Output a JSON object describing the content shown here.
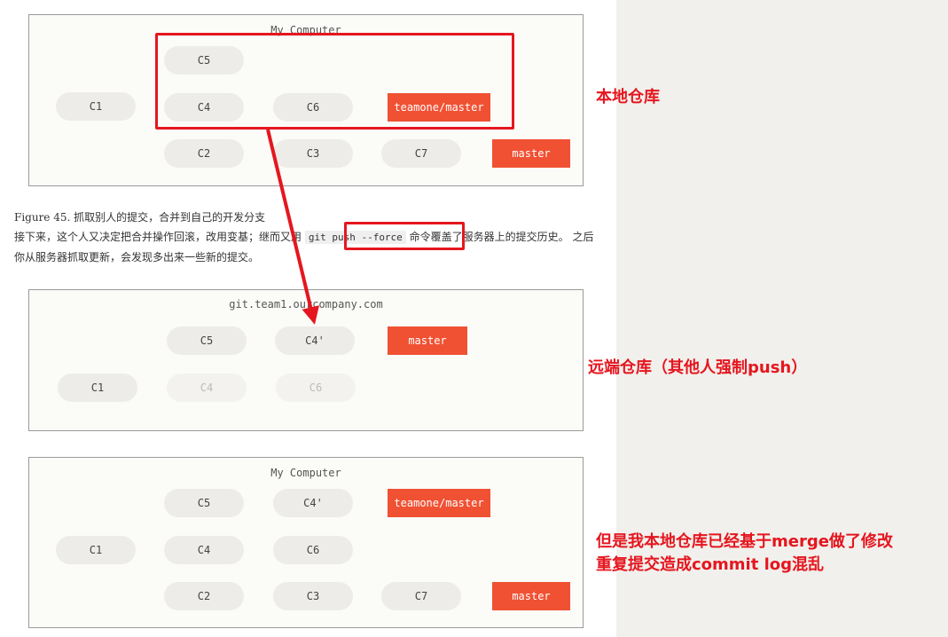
{
  "diagram1": {
    "title": "My Computer",
    "nodes": [
      "C5",
      "C1",
      "C4",
      "C6",
      "C2",
      "C3",
      "C7"
    ],
    "refs": [
      "teamone/master",
      "master"
    ]
  },
  "caption": {
    "figure_label": "Figure 45.",
    "figure_title": "抓取别人的提交，合并到自己的开发分支",
    "line1_before": "接下来，这个人又决定把合并操作回滚，改用变基；继而又用",
    "code": "git push --force",
    "line1_after": "命令覆盖了服务器上的提交历史。 之后你从服务器抓取更新，会发现多出来一些新的提交。"
  },
  "diagram2": {
    "title": "git.team1.ourcompany.com",
    "nodes": [
      "C5",
      "C4'",
      "C1",
      "C4",
      "C6"
    ],
    "refs": [
      "master"
    ]
  },
  "diagram3": {
    "title": "My Computer",
    "nodes": [
      "C5",
      "C4'",
      "C1",
      "C4",
      "C6",
      "C2",
      "C3",
      "C7"
    ],
    "refs": [
      "teamone/master",
      "master"
    ]
  },
  "annotations": {
    "local_repo": "本地仓库",
    "remote_repo": "远端仓库（其他人强制push）",
    "note_line1": "但是我本地仓库已经基于merge做了修改",
    "note_line2": "重复提交造成commit log混乱"
  },
  "colors": {
    "ref_bg": "#f05133",
    "annotation": "#e5161f",
    "node_bg": "#eeece8"
  }
}
